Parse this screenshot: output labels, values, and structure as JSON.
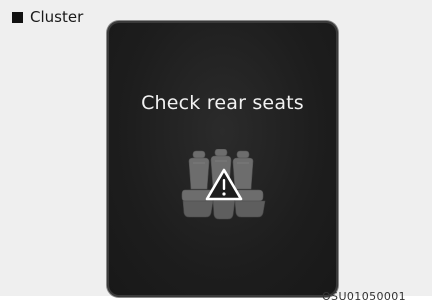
{
  "section": {
    "title": "Cluster"
  },
  "display": {
    "message": "Check rear seats",
    "icon": "rear-seat-warning-icon"
  },
  "reference_code": "OSU01050001"
}
